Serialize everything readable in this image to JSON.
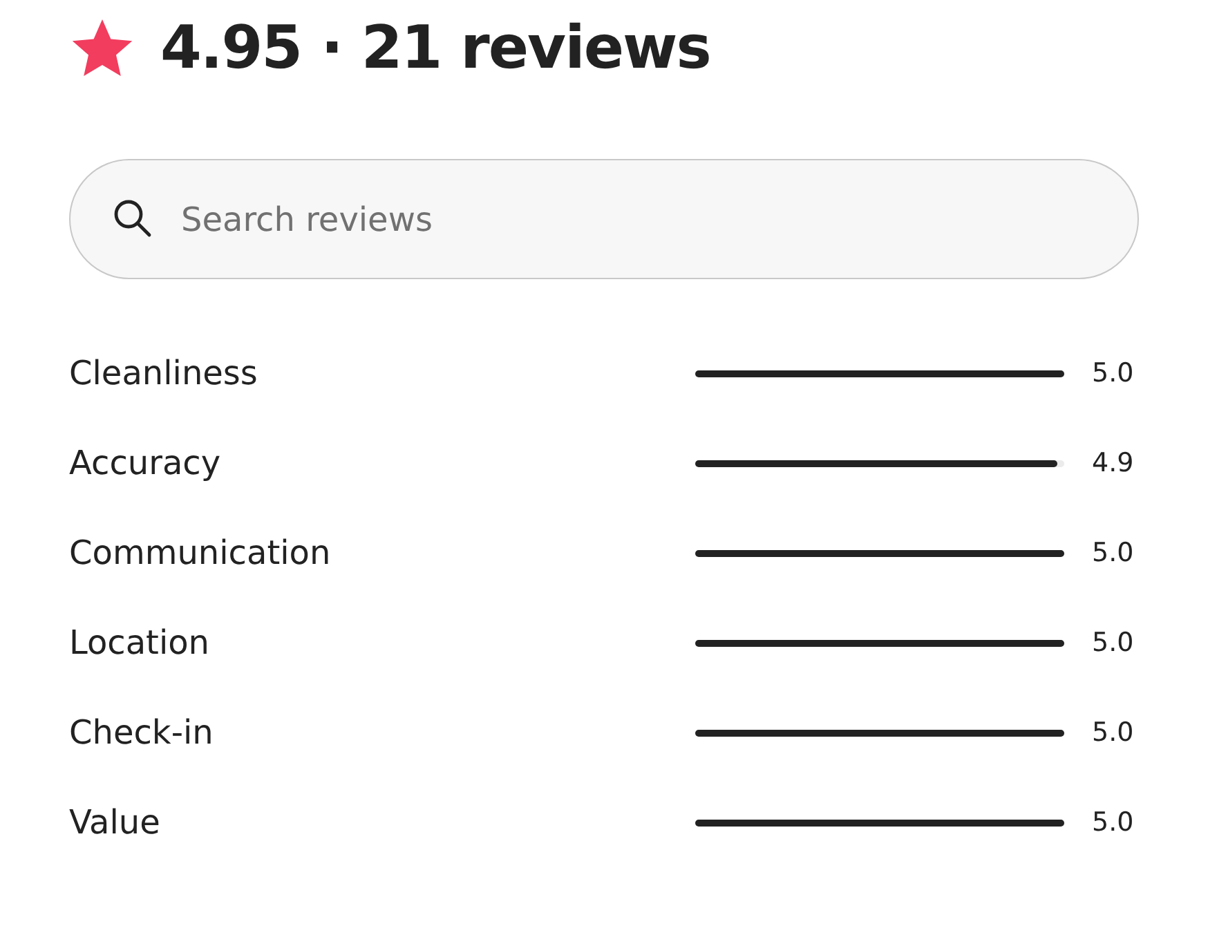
{
  "summary": {
    "title": "4.95 · 21 reviews"
  },
  "search": {
    "placeholder": "Search reviews"
  },
  "ratings": [
    {
      "label": "Cleanliness",
      "level": 1.0,
      "reading": "5.0"
    },
    {
      "label": "Accuracy",
      "level": 0.98,
      "reading": "4.9"
    },
    {
      "label": "Communication",
      "level": 1.0,
      "reading": "5.0"
    },
    {
      "label": "Location",
      "level": 1.0,
      "reading": "5.0"
    },
    {
      "label": "Check-in",
      "level": 1.0,
      "reading": "5.0"
    },
    {
      "label": "Value",
      "level": 1.0,
      "reading": "5.0"
    }
  ]
}
